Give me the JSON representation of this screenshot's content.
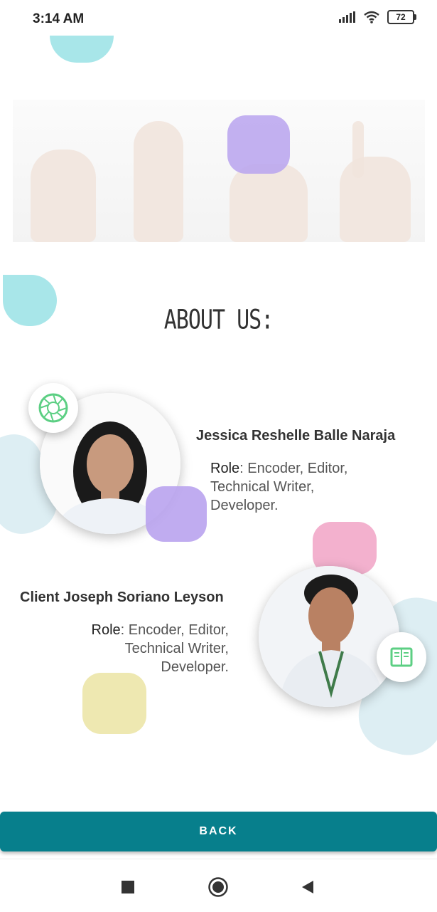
{
  "status_bar": {
    "time": "3:14 AM",
    "battery": "72"
  },
  "page": {
    "title": "ABOUT US:"
  },
  "members": [
    {
      "name": "Jessica Reshelle Balle Naraja",
      "role_label": "Role",
      "role_text": ": Encoder, Editor,",
      "role_line2": "Technical Writer,",
      "role_line3": "Developer.",
      "icon": "camera-aperture-icon"
    },
    {
      "name": "Client Joseph Soriano Leyson",
      "role_label": "Role",
      "role_text": ": Encoder, Editor,",
      "role_line2": "Technical Writer,",
      "role_line3": "Developer.",
      "icon": "book-icon"
    }
  ],
  "back_button": {
    "label": "BACK"
  },
  "nav": {
    "recents": "square-icon",
    "home": "circle-icon",
    "back": "triangle-back-icon"
  },
  "colors": {
    "accent": "#077f8c",
    "cyan": "#a8e6e9",
    "purple": "#b9a3ee",
    "pink": "#f2a9c9",
    "yellow": "#ece5a8"
  }
}
